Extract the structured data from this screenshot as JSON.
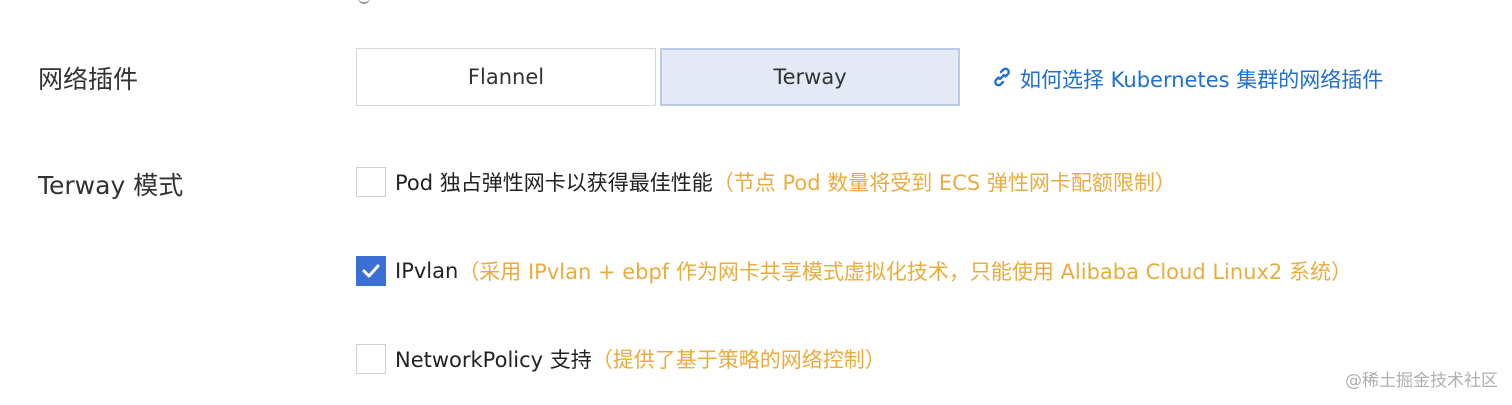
{
  "network_plugin": {
    "label": "网络插件",
    "options": [
      {
        "label": "Flannel",
        "selected": false
      },
      {
        "label": "Terway",
        "selected": true
      }
    ],
    "help_link": {
      "icon": "link-icon",
      "text": "如何选择 Kubernetes 集群的网络插件"
    }
  },
  "terway_mode": {
    "label": "Terway 模式",
    "options": [
      {
        "label": "Pod 独占弹性网卡以获得最佳性能",
        "note": "（节点 Pod 数量将受到 ECS 弹性网卡配额限制）",
        "checked": false
      },
      {
        "label": "IPvlan",
        "note": "（采用 IPvlan + ebpf 作为网卡共享模式虚拟化技术，只能使用 Alibaba Cloud Linux2 系统）",
        "checked": true
      },
      {
        "label": "NetworkPolicy 支持",
        "note": "（提供了基于策略的网络控制）",
        "checked": false
      }
    ]
  },
  "watermark": "@稀土掘金技术社区",
  "colors": {
    "link": "#1f6fd0",
    "note": "#e9ac3e",
    "selected_bg": "#e3eaf6",
    "checkbox_checked": "#3b6fd4"
  }
}
